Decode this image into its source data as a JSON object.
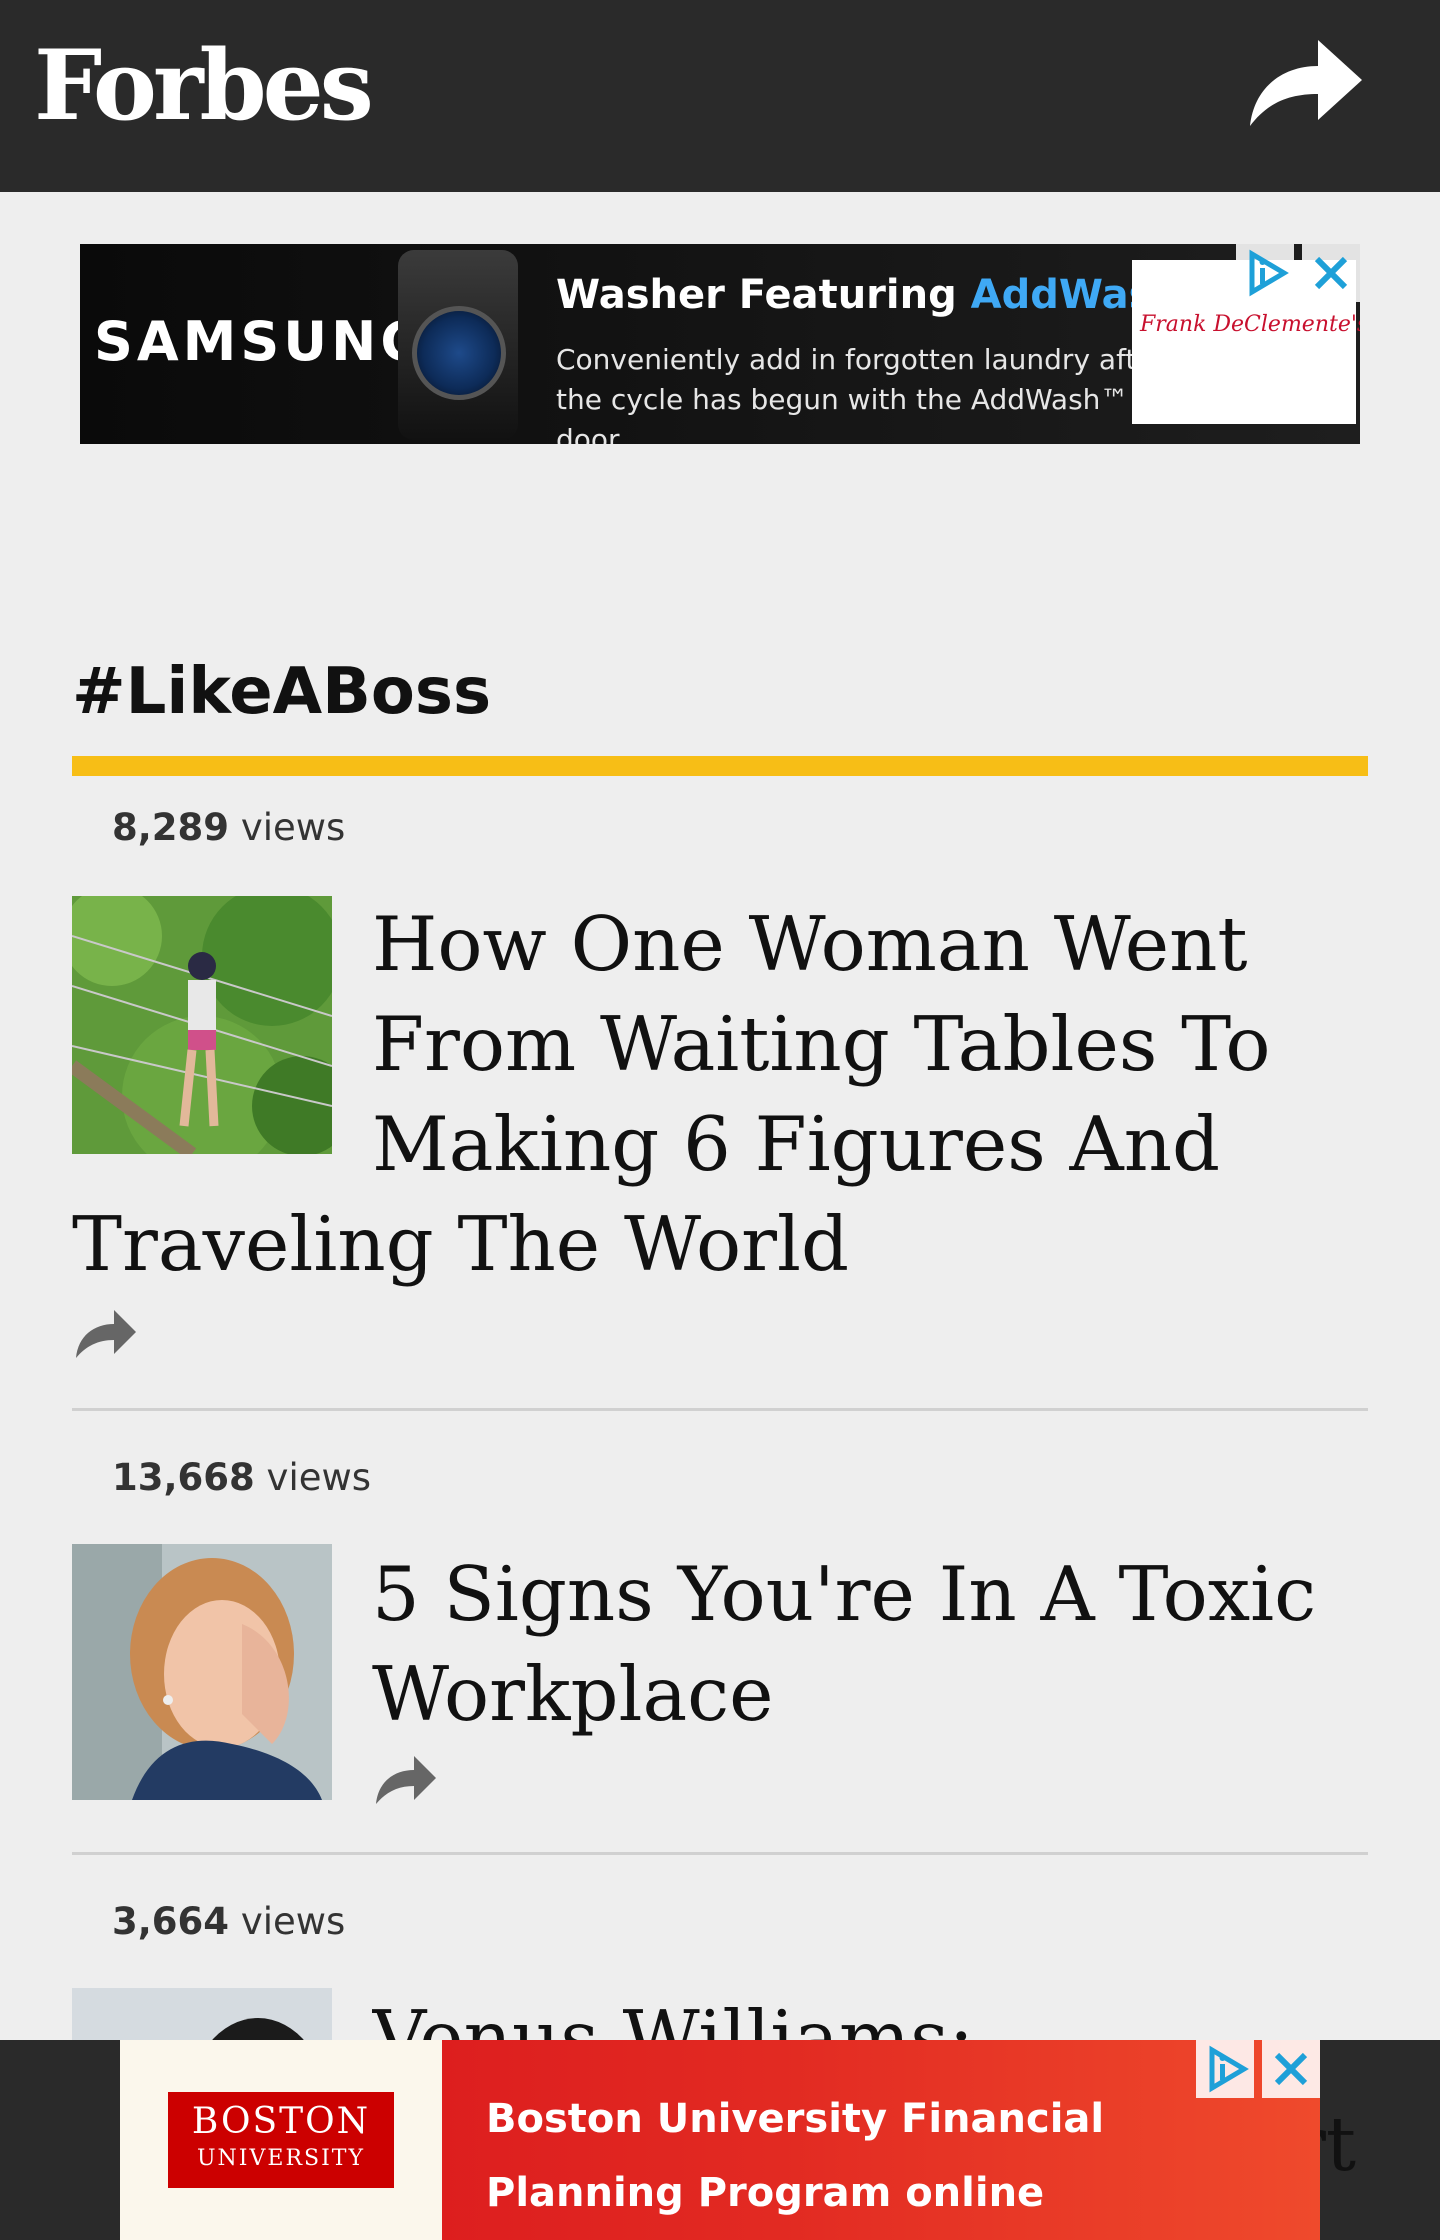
{
  "header": {
    "logo": "Forbes",
    "share_icon": "share-arrow-icon"
  },
  "ad_top": {
    "brand": "SAMSUNG",
    "headline_prefix": "Washer Featuring ",
    "headline_highlight": "AddWash™",
    "subtext": "Conveniently add in forgotten laundry after the cycle has begun with the AddWash™ door.",
    "dealer": "Frank DeClemente's Inc.",
    "adchoices_icon": "adchoices-icon",
    "close_icon": "close-icon"
  },
  "section": {
    "title": "#LikeABoss",
    "accent_color": "#f7be16"
  },
  "articles": [
    {
      "views_count": "8,289",
      "views_label": "views",
      "title": "How One Woman Went From Waiting Tables To Making 6 Figures And Traveling The World",
      "thumb": "zipline-photo"
    },
    {
      "views_count": "13,668",
      "views_label": "views",
      "title": "5 Signs You're In A Toxic Workplace",
      "thumb": "stressed-woman-photo"
    },
    {
      "views_count": "3,664",
      "views_label": "views",
      "title": "Venus Williams:",
      "title_fragment_right": "rt",
      "thumb": "venus-williams-photo"
    }
  ],
  "ad_bottom": {
    "logo_line1": "BOSTON",
    "logo_line2": "UNIVERSITY",
    "message_line1": "Boston University Financial",
    "message_line2": "Planning Program online",
    "adchoices_icon": "adchoices-icon",
    "close_icon": "close-icon"
  }
}
